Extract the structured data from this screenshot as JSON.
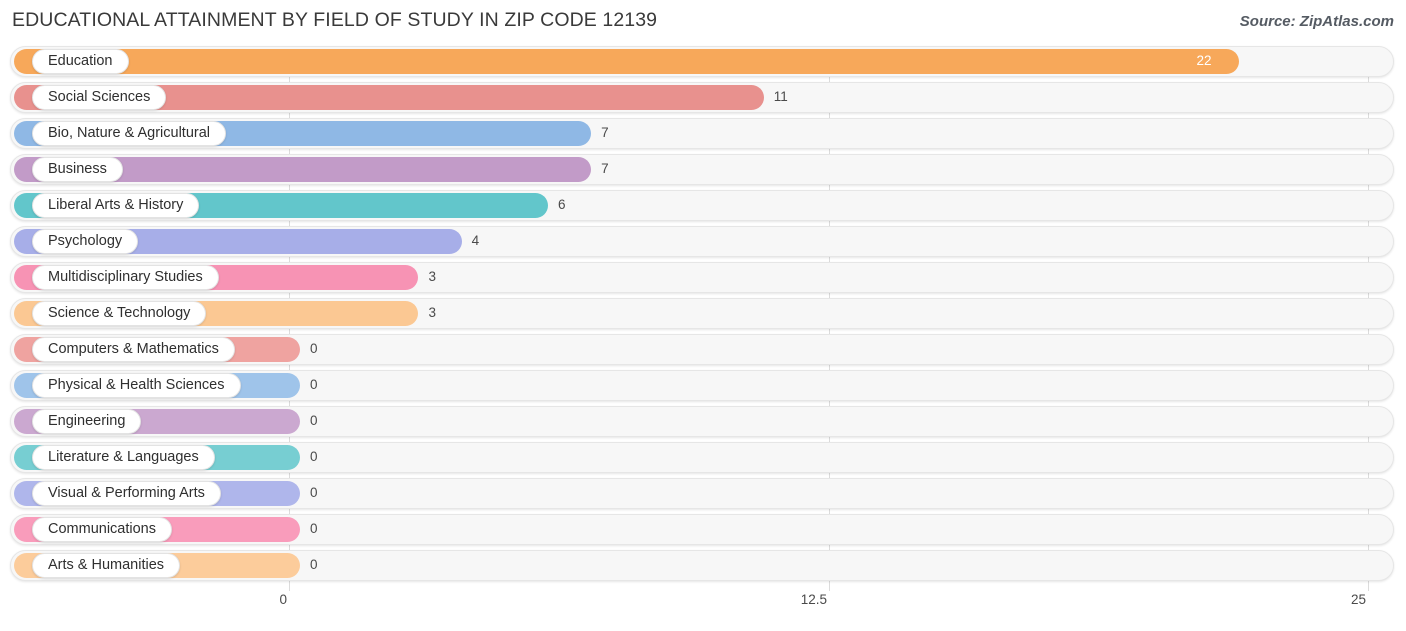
{
  "header": {
    "title": "EDUCATIONAL ATTAINMENT BY FIELD OF STUDY IN ZIP CODE 12139",
    "source": "Source: ZipAtlas.com"
  },
  "chart_data": {
    "type": "bar",
    "orientation": "horizontal",
    "title": "EDUCATIONAL ATTAINMENT BY FIELD OF STUDY IN ZIP CODE 12139",
    "xlabel": "",
    "ylabel": "",
    "xlim": [
      0,
      25
    ],
    "grid": true,
    "legend": "none",
    "tick_labels": [
      "0",
      "12.5",
      "25"
    ],
    "tick_values": [
      0,
      12.5,
      25
    ],
    "categories": [
      "Education",
      "Social Sciences",
      "Bio, Nature & Agricultural",
      "Business",
      "Liberal Arts & History",
      "Psychology",
      "Multidisciplinary Studies",
      "Science & Technology",
      "Computers & Mathematics",
      "Physical & Health Sciences",
      "Engineering",
      "Literature & Languages",
      "Visual & Performing Arts",
      "Communications",
      "Arts & Humanities"
    ],
    "values": [
      22,
      11,
      7,
      7,
      6,
      4,
      3,
      3,
      0,
      0,
      0,
      0,
      0,
      0,
      0
    ],
    "value_labels": [
      "22",
      "11",
      "7",
      "7",
      "6",
      "4",
      "3",
      "3",
      "0",
      "0",
      "0",
      "0",
      "0",
      "0",
      "0"
    ],
    "colors": [
      "#F7A85A",
      "#E8918E",
      "#8FB8E5",
      "#C29BC8",
      "#62C6CB",
      "#A7AEE8",
      "#F793B4",
      "#FBC893",
      "#EFA3A0",
      "#9FC4EA",
      "#CBA8D0",
      "#77CED2",
      "#AFB6EB",
      "#F99CBB",
      "#FCCC9B"
    ],
    "label_inside_bar": [
      true,
      false,
      false,
      false,
      false,
      false,
      false,
      false,
      false,
      false,
      false,
      false,
      false,
      false,
      false
    ]
  }
}
